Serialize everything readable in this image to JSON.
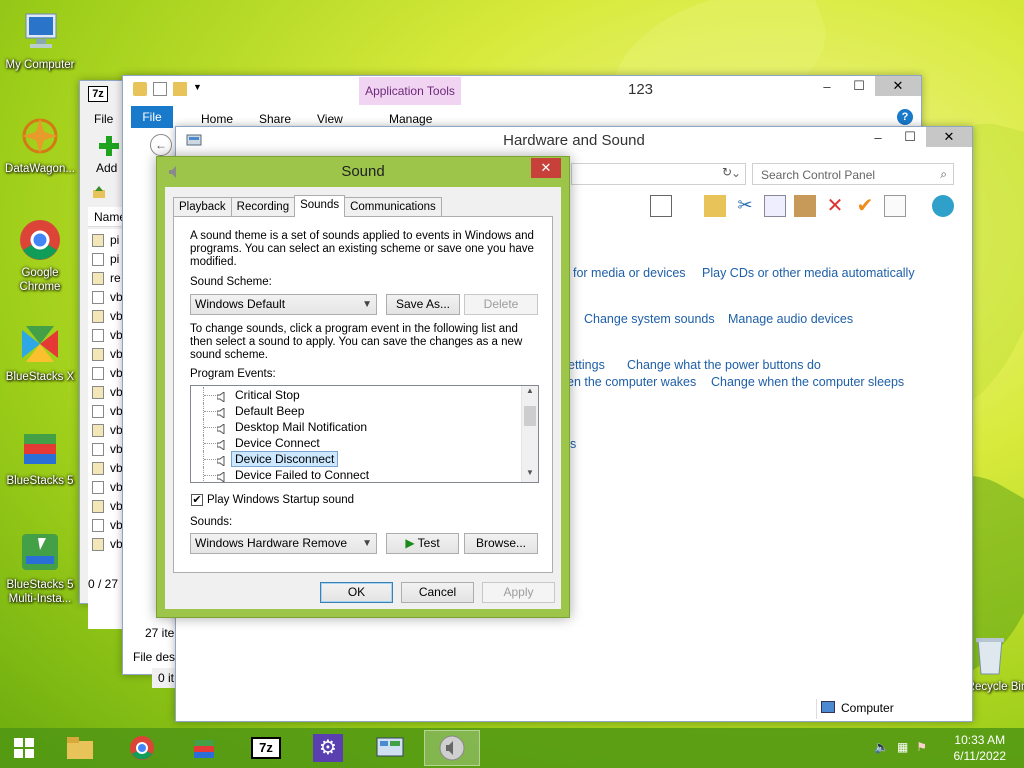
{
  "desktop": {
    "icons": [
      {
        "label": "My Computer"
      },
      {
        "label": "DataWagon..."
      },
      {
        "label": "Google Chrome"
      },
      {
        "label": "BlueStacks X"
      },
      {
        "label": "BlueStacks 5"
      },
      {
        "label": "BlueStacks 5 Multi-Insta..."
      },
      {
        "label": "Recycle Bin"
      }
    ]
  },
  "sevenzip_window": {
    "logo": "7z",
    "menu_file": "File",
    "add_label": "Add",
    "col_name": "Name",
    "files": [
      "pi",
      "pi",
      "re",
      "vb",
      "vb",
      "vb",
      "vb",
      "vb",
      "vb",
      "vb",
      "vb",
      "vb",
      "vb",
      "vb",
      "vb",
      "vb",
      "vb"
    ],
    "status": "0 / 27 "
  },
  "explorer_window": {
    "title": "123",
    "context_tab": "Application Tools",
    "tabs": [
      "File",
      "Home",
      "Share",
      "View"
    ],
    "context_sub": "Manage",
    "items_count": "27 ite",
    "status1": "File desc",
    "status2": "0 it"
  },
  "control_panel": {
    "title": "Hardware and Sound",
    "search_placeholder": "Search Control Panel",
    "links": [
      "for media or devices",
      "Play CDs or other media automatically",
      "Change system sounds",
      "Manage audio devices",
      "ettings",
      "Change what the power buttons do",
      "en the computer wakes",
      "Change when the computer sleeps",
      "s"
    ],
    "status_computer": "Computer"
  },
  "sound_dialog": {
    "title": "Sound",
    "tabs": [
      "Playback",
      "Recording",
      "Sounds",
      "Communications"
    ],
    "active_tab": "Sounds",
    "intro": "A sound theme is a set of sounds applied to events in Windows and programs.  You can select an existing scheme or save one you have modified.",
    "scheme_label": "Sound Scheme:",
    "scheme_value": "Windows Default",
    "save_as": "Save As...",
    "delete": "Delete",
    "instructions": "To change sounds, click a program event in the following list and then select a sound to apply.  You can save the changes as a new sound scheme.",
    "events_label": "Program Events:",
    "events": [
      "Critical Stop",
      "Default Beep",
      "Desktop Mail Notification",
      "Device Connect",
      "Device Disconnect",
      "Device Failed to Connect"
    ],
    "selected_event": "Device Disconnect",
    "startup_checkbox": "Play Windows Startup sound",
    "startup_checked": true,
    "sounds_label": "Sounds:",
    "sound_value": "Windows Hardware Remove",
    "test": "Test",
    "browse": "Browse...",
    "ok": "OK",
    "cancel": "Cancel",
    "apply": "Apply"
  },
  "taskbar": {
    "apps": [
      "file-explorer-icon",
      "chrome-icon",
      "bluestacks-icon",
      "7zip-icon",
      "control-panel-icon",
      "remote-desktop-icon",
      "sound-icon"
    ],
    "time": "10:33 AM",
    "date": "6/11/2022"
  },
  "colors": {
    "accent": "#9cc54a",
    "link": "#1e5fa8",
    "close_red": "#c7413a",
    "ribbon_file": "#1979ca"
  }
}
